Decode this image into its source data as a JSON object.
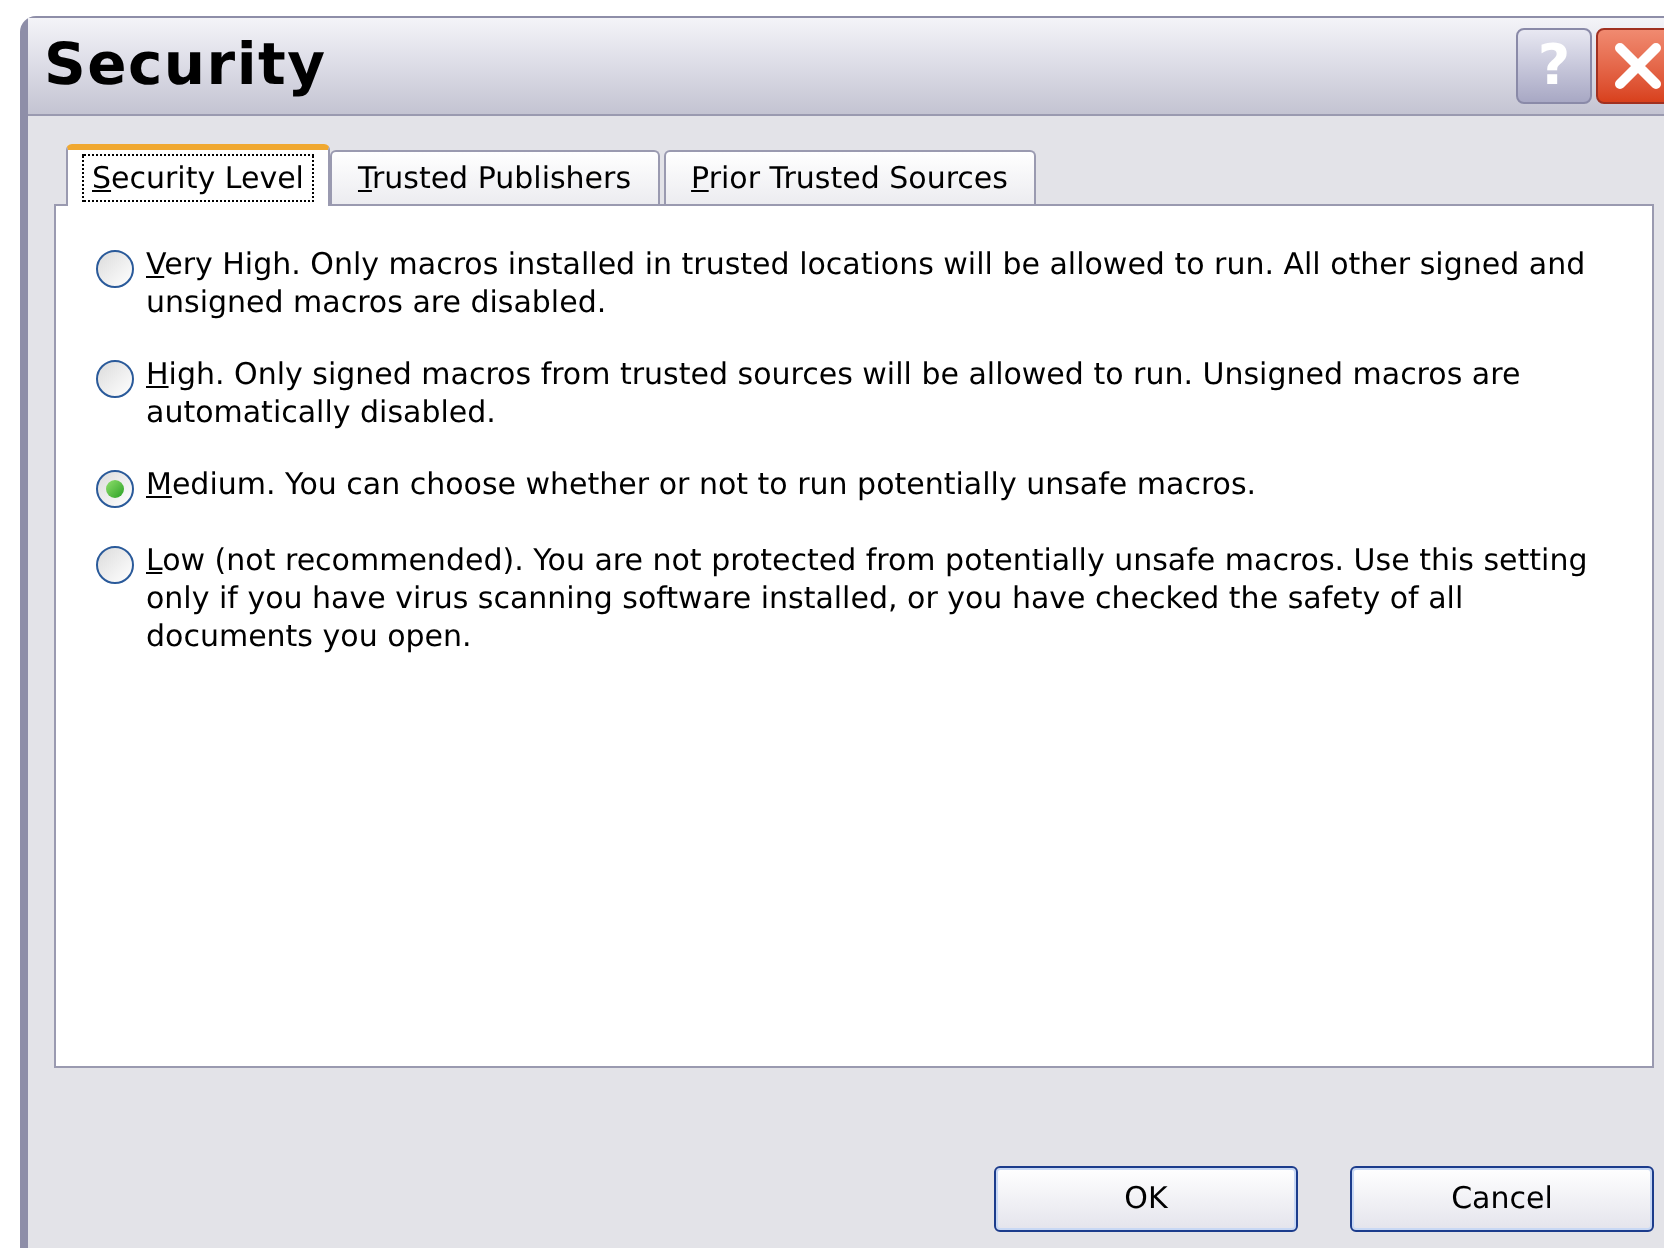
{
  "window": {
    "title": "Security",
    "help_button": "?"
  },
  "tabs": [
    {
      "label": "Security Level",
      "selected": true
    },
    {
      "label": "Trusted Publishers",
      "selected": false
    },
    {
      "label": "Prior Trusted Sources",
      "selected": false
    }
  ],
  "options": [
    {
      "label": "Very High. Only macros installed in trusted locations will be allowed to run. All other signed and unsigned macros are disabled.",
      "selected": false
    },
    {
      "label": "High. Only signed macros from trusted sources will be allowed to run. Unsigned macros are automatically disabled.",
      "selected": false
    },
    {
      "label": "Medium. You can choose whether or not to run potentially unsafe macros.",
      "selected": true
    },
    {
      "label": "Low (not recommended). You are not protected from potentially unsafe macros. Use this setting only if you have virus scanning software installed, or you have checked the safety of all documents you open.",
      "selected": false
    }
  ],
  "buttons": [
    "OK",
    "Cancel"
  ]
}
